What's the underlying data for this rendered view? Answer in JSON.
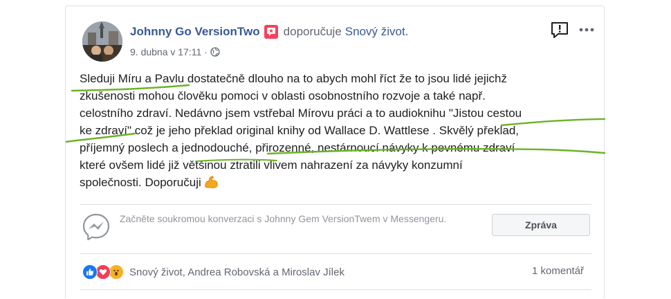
{
  "post": {
    "author": "Johnny Go VersionTwo",
    "verb": "doporučuje",
    "page": "Snový život.",
    "timestamp": "9. dubna v 17:11 ·",
    "body_lines": [
      "Sleduji Míru a Pavlu dostatečně dlouho na to abych mohl říct že to jsou lidé jejichž",
      "zkušenosti mohou člověku pomoci v oblasti osobnostního rozvoje a také např.",
      "celostního zdraví. Nedávno jsem vstřebal Mírovu práci a to audioknihu \"Jistou cestou",
      "ke zdraví\" což je jeho překlad original knihy od Wallace D. Wattlese . Skvělý překlad,",
      "příjemný poslech a jednodouché, přirozenné, nestárnoucí návyky k pevnému zdraví",
      "které ovšem lidé již většinou ztratili vlivem nahrazení za návyky konzumní",
      "společnosti. Doporučuji"
    ],
    "icons": {
      "recommend": "recommend-star-icon",
      "privacy": "globe-icon",
      "report": "report-icon",
      "more": "more-dots-icon",
      "emoji": "flexed-biceps-emoji"
    }
  },
  "messenger": {
    "prompt": "Začněte soukromou konverzaci s Johnny Gem VersionTwem v Messengeru.",
    "button_label": "Zpráva",
    "icon": "messenger-icon"
  },
  "reactions": {
    "types": [
      "like",
      "love",
      "wow"
    ],
    "names": "Snový život, Andrea Robovská a Miroslav Jílek",
    "comments": "1 komentář"
  },
  "colors": {
    "link": "#385898",
    "secondary_text": "#606770",
    "annotation": "#6bb324",
    "recommend_badge": "#f3425f"
  }
}
